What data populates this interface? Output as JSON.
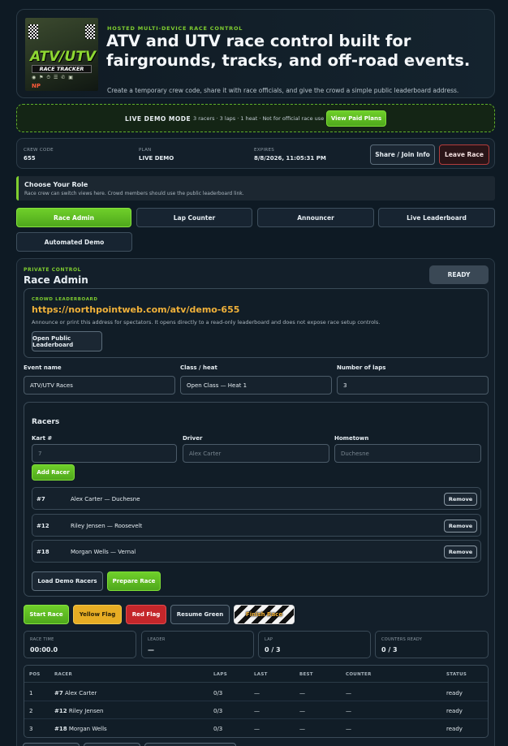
{
  "hero": {
    "kicker": "HOSTED MULTI-DEVICE RACE CONTROL",
    "title": "ATV and UTV race control built for fairgrounds, tracks, and off-road events.",
    "subtitle": "Create a temporary crew code, share it with race officials, and give the crowd a simple public leaderboard address.",
    "logo": {
      "line1": "ATV/UTV",
      "line2": "RACE TRACKER",
      "brand": "NP"
    }
  },
  "demo": {
    "label": "LIVE DEMO MODE",
    "info": "3 racers · 3 laps · 1 heat · Not for official race use",
    "button": "View Paid Plans"
  },
  "crew": {
    "code_label": "CREW CODE",
    "code": "655",
    "plan_label": "PLAN",
    "plan": "LIVE DEMO",
    "expires_label": "EXPIRES",
    "expires": "8/8/2026, 11:05:31 PM",
    "share_button": "Share / Join Info",
    "leave_button": "Leave Race"
  },
  "role": {
    "title": "Choose Your Role",
    "subtitle": "Race crew can switch views here. Crowd members should use the public leaderboard link.",
    "tabs": [
      "Race Admin",
      "Lap Counter",
      "Announcer",
      "Live Leaderboard",
      "Automated Demo"
    ]
  },
  "admin": {
    "kicker": "PRIVATE CONTROL",
    "title": "Race Admin",
    "status": "READY",
    "leaderboard": {
      "kicker": "CROWD LEADERBOARD",
      "url": "https://northpointweb.com/atv/demo-655",
      "desc": "Announce or print this address for spectators. It opens directly to a read-only leaderboard and does not expose race setup controls.",
      "button": "Open Public Leaderboard"
    },
    "event_label": "Event name",
    "event_value": "ATV/UTV Races",
    "class_label": "Class / heat",
    "class_value": "Open Class — Heat 1",
    "laps_label": "Number of laps",
    "laps_value": "3",
    "racers": {
      "title": "Racers",
      "kart_label": "Kart #",
      "kart_placeholder": "7",
      "driver_label": "Driver",
      "driver_placeholder": "Alex Carter",
      "hometown_label": "Hometown",
      "hometown_placeholder": "Duchesne",
      "add_button": "Add Racer",
      "list": [
        {
          "num": "#7",
          "name": "Alex Carter — Duchesne"
        },
        {
          "num": "#12",
          "name": "Riley Jensen — Roosevelt"
        },
        {
          "num": "#18",
          "name": "Morgan Wells — Vernal"
        }
      ],
      "remove_label": "Remove",
      "load_demo": "Load Demo Racers",
      "prepare": "Prepare Race"
    },
    "controls": {
      "start": "Start Race",
      "yellow": "Yellow Flag",
      "red": "Red Flag",
      "resume": "Resume Green",
      "finish": "Finish Race"
    },
    "stats": [
      {
        "label": "RACE TIME",
        "value": "00:00.0"
      },
      {
        "label": "LEADER",
        "value": "—"
      },
      {
        "label": "LAP",
        "value": "0 / 3"
      },
      {
        "label": "COUNTERS READY",
        "value": "0 / 3"
      }
    ],
    "table": {
      "headers": [
        "POS",
        "RACER",
        "LAPS",
        "LAST",
        "BEST",
        "COUNTER",
        "STATUS"
      ],
      "rows": [
        {
          "pos": "1",
          "num": "#7",
          "name": "Alex Carter",
          "laps": "0/3",
          "last": "—",
          "best": "—",
          "counter": "—",
          "status": "ready"
        },
        {
          "pos": "2",
          "num": "#12",
          "name": "Riley Jensen",
          "laps": "0/3",
          "last": "—",
          "best": "—",
          "counter": "—",
          "status": "ready"
        },
        {
          "pos": "3",
          "num": "#18",
          "name": "Morgan Wells",
          "laps": "0/3",
          "last": "—",
          "best": "—",
          "counter": "—",
          "status": "ready"
        }
      ]
    }
  }
}
